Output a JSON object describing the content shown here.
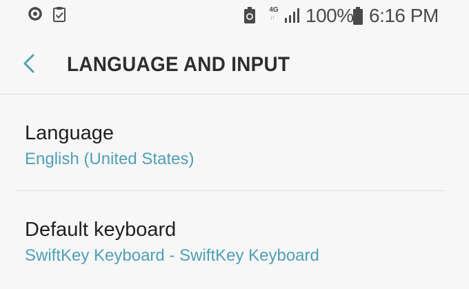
{
  "status_bar": {
    "icons": [
      "sync-icon",
      "task-check-icon",
      "battery-saver-icon",
      "network-4g-icon",
      "signal-icon",
      "battery-icon"
    ],
    "network_label": "4G",
    "battery_percent": "100%",
    "time": "6:16 PM"
  },
  "header": {
    "back_icon": "chevron-left-icon",
    "title": "LANGUAGE AND INPUT"
  },
  "settings": {
    "items": [
      {
        "title": "Language",
        "subtitle": "English (United States)"
      },
      {
        "title": "Default keyboard",
        "subtitle": "SwiftKey Keyboard - SwiftKey Keyboard"
      }
    ]
  },
  "colors": {
    "accent": "#4f9fb6",
    "title_text": "#2e2e2e",
    "background": "#f7f7f7",
    "status_icons": "#4a4a4a"
  }
}
